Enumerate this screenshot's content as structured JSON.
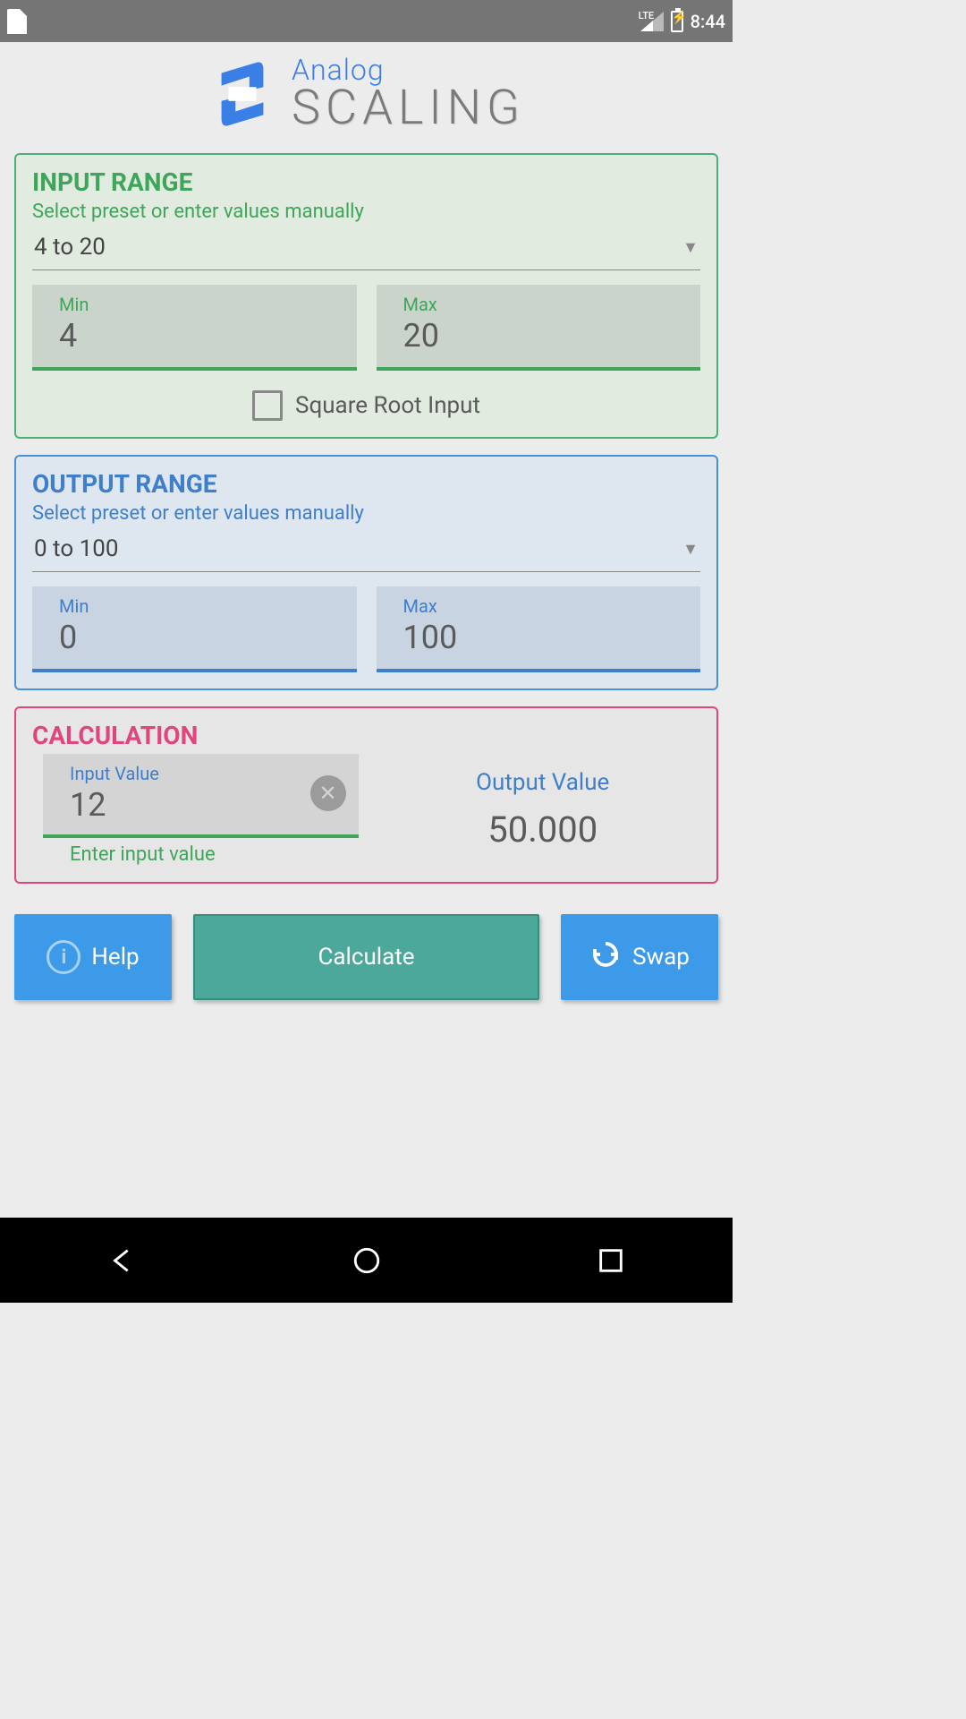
{
  "status": {
    "clock": "8:44",
    "network": "LTE"
  },
  "app": {
    "title_top": "Analog",
    "title_bottom": "SCALING"
  },
  "input_range": {
    "title": "INPUT RANGE",
    "subtext": "Select preset or enter values manually",
    "preset": "4 to 20",
    "min_label": "Min",
    "max_label": "Max",
    "min": "4",
    "max": "20",
    "sqrt_label": "Square Root Input"
  },
  "output_range": {
    "title": "OUTPUT RANGE",
    "subtext": "Select preset or enter values manually",
    "preset": "0 to 100",
    "min_label": "Min",
    "max_label": "Max",
    "min": "0",
    "max": "100"
  },
  "calculation": {
    "title": "CALCULATION",
    "input_label": "Input Value",
    "input_value": "12",
    "helper": "Enter input value",
    "output_label": "Output Value",
    "output_value": "50.000"
  },
  "buttons": {
    "help": "Help",
    "calculate": "Calculate",
    "swap": "Swap"
  }
}
